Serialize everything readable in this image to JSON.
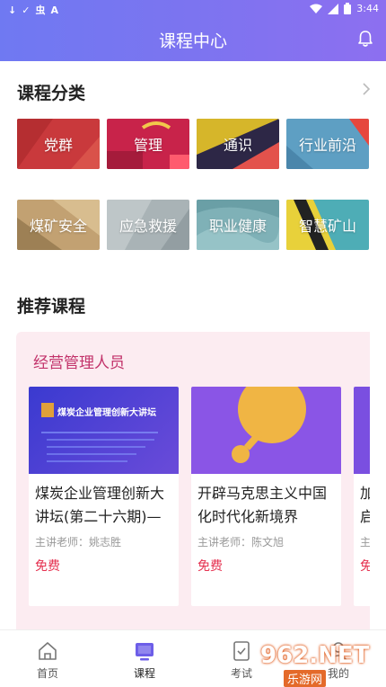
{
  "status_bar": {
    "left_icons": [
      "check-icon",
      "check-icon",
      "app-icon",
      "a-icon"
    ],
    "left_text": [
      "↓",
      "✓",
      "虫",
      "A"
    ],
    "time": "3:44"
  },
  "header": {
    "title": "课程中心"
  },
  "categories": {
    "title": "课程分类",
    "items": [
      {
        "label": "党群",
        "color": "#c9393c"
      },
      {
        "label": "管理",
        "color": "#c8234a"
      },
      {
        "label": "通识",
        "color": "#d6b62a"
      },
      {
        "label": "行业前沿",
        "color": "#5e9fc3"
      },
      {
        "label": "煤矿安全",
        "color": "#c2a172"
      },
      {
        "label": "应急救援",
        "color": "#a9b3b6"
      },
      {
        "label": "职业健康",
        "color": "#7fb1b7"
      },
      {
        "label": "智慧矿山",
        "color": "#4eadb6"
      }
    ]
  },
  "recommend": {
    "title": "推荐课程",
    "group_title": "经营管理人员",
    "courses": [
      {
        "thumb_title": "煤炭企业管理创新大讲坛",
        "title": "煤炭企业管理创新大讲坛(第二十六期)—",
        "teacher": "主讲老师：姚志胜",
        "price": "免费"
      },
      {
        "title": "开辟马克思主义中国化时代化新境界",
        "teacher": "主讲老师：陈文旭",
        "price": "免费"
      },
      {
        "title": "加启",
        "teacher": "主",
        "price": "免"
      }
    ]
  },
  "tabbar": {
    "tabs": [
      {
        "label": "首页"
      },
      {
        "label": "课程"
      },
      {
        "label": "考试"
      },
      {
        "label": "我的"
      }
    ]
  },
  "watermark": {
    "logo": "962.NET",
    "sub": "乐游网"
  }
}
